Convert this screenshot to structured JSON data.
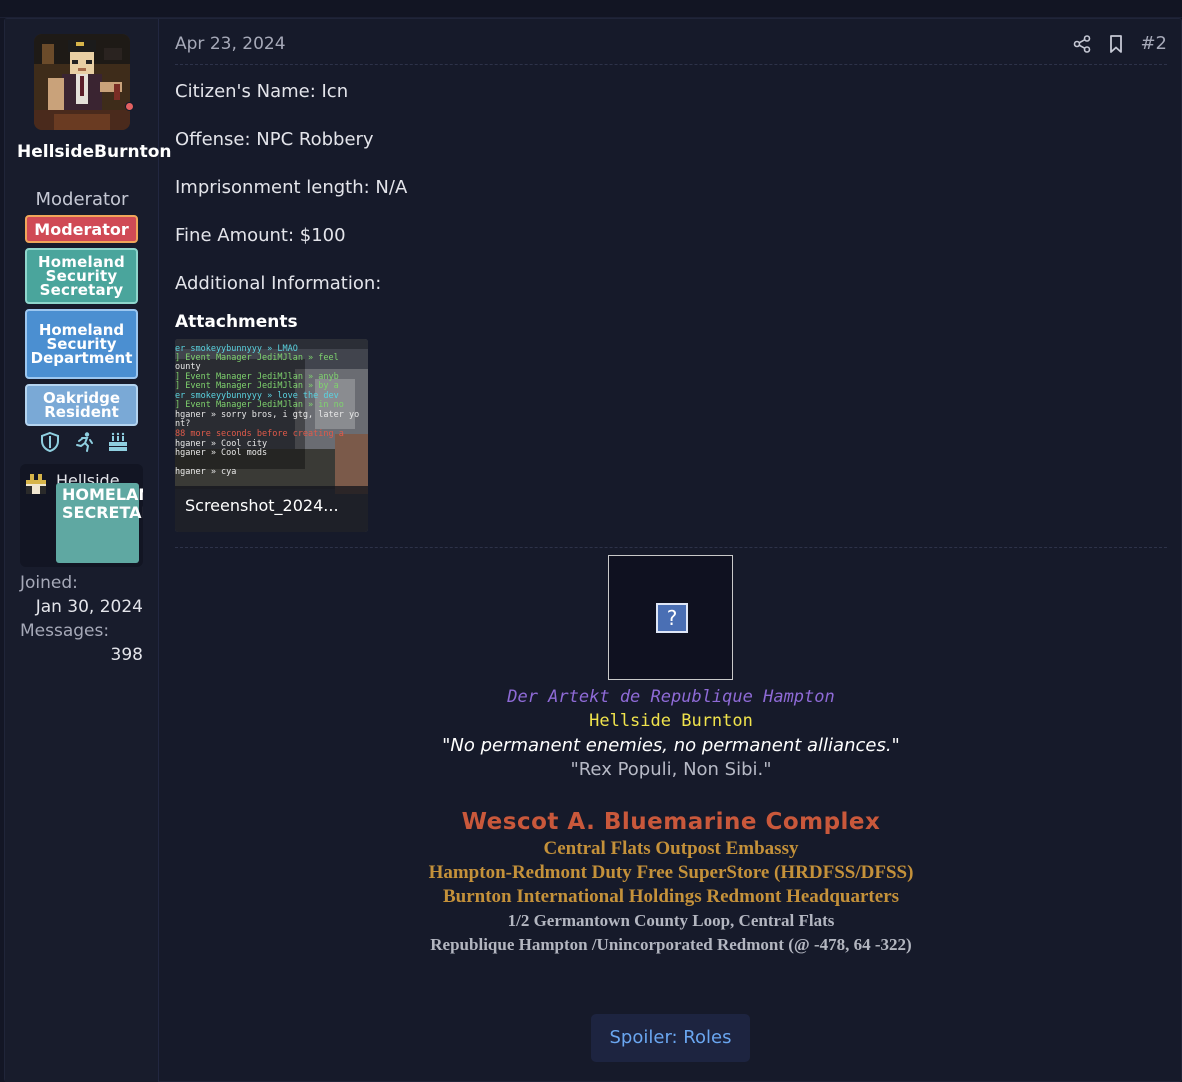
{
  "user": {
    "name": "HellsideBurnton",
    "title": "Moderator",
    "banners": [
      "Moderator",
      "Homeland Security Secretary",
      "Homeland Security Department",
      "Oakridge Resident"
    ],
    "mini_name": "Hellside",
    "mini_badge": "HOMELAND SECRETARY",
    "joined_label": "Joined:",
    "joined_value": "Jan 30, 2024",
    "messages_label": "Messages:",
    "messages_value": "398",
    "trophy_icons": [
      "shield-icon",
      "running-person-icon",
      "birthday-cake-icon"
    ]
  },
  "post": {
    "date": "Apr 23, 2024",
    "number": "#2",
    "lines": [
      "Citizen's Name: Icn",
      "Offense: NPC Robbery",
      "Imprisonment length: N/A",
      "Fine Amount: $100",
      "Additional Information:"
    ],
    "attachments_title": "Attachments",
    "attachment_caption": "Screenshot_2024...",
    "attachment_chat": [
      "er smokeyybunnyyy » LMAO",
      "] Event Manager JediMJlan » feel",
      "ounty",
      "] Event Manager JediMJlan » anyb",
      "] Event Manager JediMJlan » by a",
      "er smokeyybunnyyy » love the dev",
      "] Event Manager JediMJlan » in no",
      "hganer » sorry bros, i gtg, later yo",
      "nt?",
      "88 more seconds before creating a",
      "hganer » Cool city",
      "hganer » Cool mods",
      "hganer » cya"
    ]
  },
  "signature": {
    "line1": "Der Artekt de Republique Hampton",
    "line2": "Hellside Burnton",
    "line3": "\"No permanent enemies, no permanent alliances.\"",
    "line4": "\"Rex Populi, Non Sibi.\"",
    "line5": "Wescot A. Bluemarine Complex",
    "line6": "Central Flats Outpost Embassy",
    "line7": "Hampton-Redmont Duty Free SuperStore (HRDFSS/DFSS)",
    "line8": "Burnton International Holdings Redmont Headquarters",
    "line9": "1/2 Germantown County Loop, Central Flats",
    "line10": "Republique Hampton /Unincorporated Redmont (@ -478, 64 -322)",
    "broken_image_glyph": "?",
    "spoiler_label": "Spoiler: Roles"
  },
  "colors": {
    "background": "#131625",
    "moderator_banner": "#d04a55",
    "security_banner": "#4aa59c",
    "department_banner": "#4b8fd1",
    "resident_banner": "#7aa9d6",
    "spoiler_text": "#6aa6f0"
  }
}
